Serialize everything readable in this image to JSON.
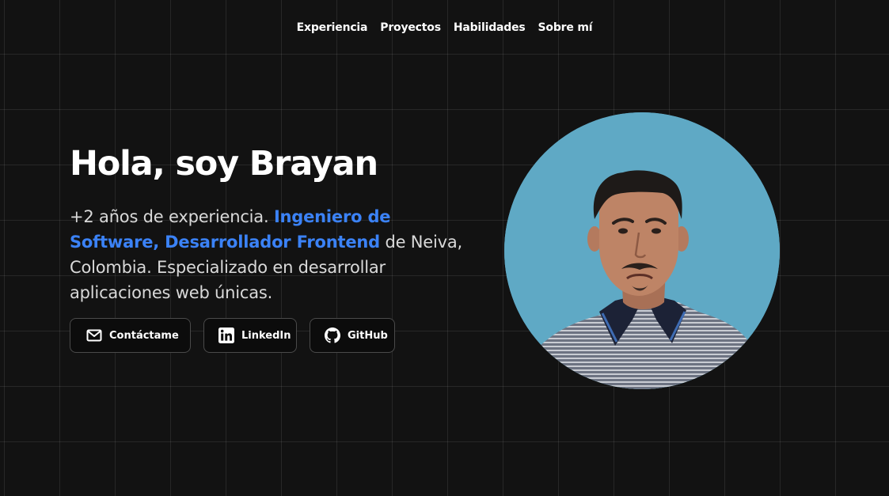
{
  "nav": {
    "items": [
      "Experiencia",
      "Proyectos",
      "Habilidades",
      "Sobre mí"
    ]
  },
  "hero": {
    "title": "Hola, soy Brayan",
    "desc_part1": "+2 años de experiencia. ",
    "desc_highlight": "Ingeniero de Software, Desarrollador Frontend",
    "desc_part2": " de Neiva, Colombia. Especializado en desarrollar aplicaciones web únicas."
  },
  "buttons": {
    "contact": {
      "label": "Contáctame",
      "icon": "mail-icon"
    },
    "linkedin": {
      "label": "LinkedIn",
      "icon": "linkedin-icon"
    },
    "github": {
      "label": "GitHub",
      "icon": "github-icon"
    }
  },
  "colors": {
    "background": "#121212",
    "accent": "#3b82f6",
    "photo_background": "#5fa9c5"
  }
}
